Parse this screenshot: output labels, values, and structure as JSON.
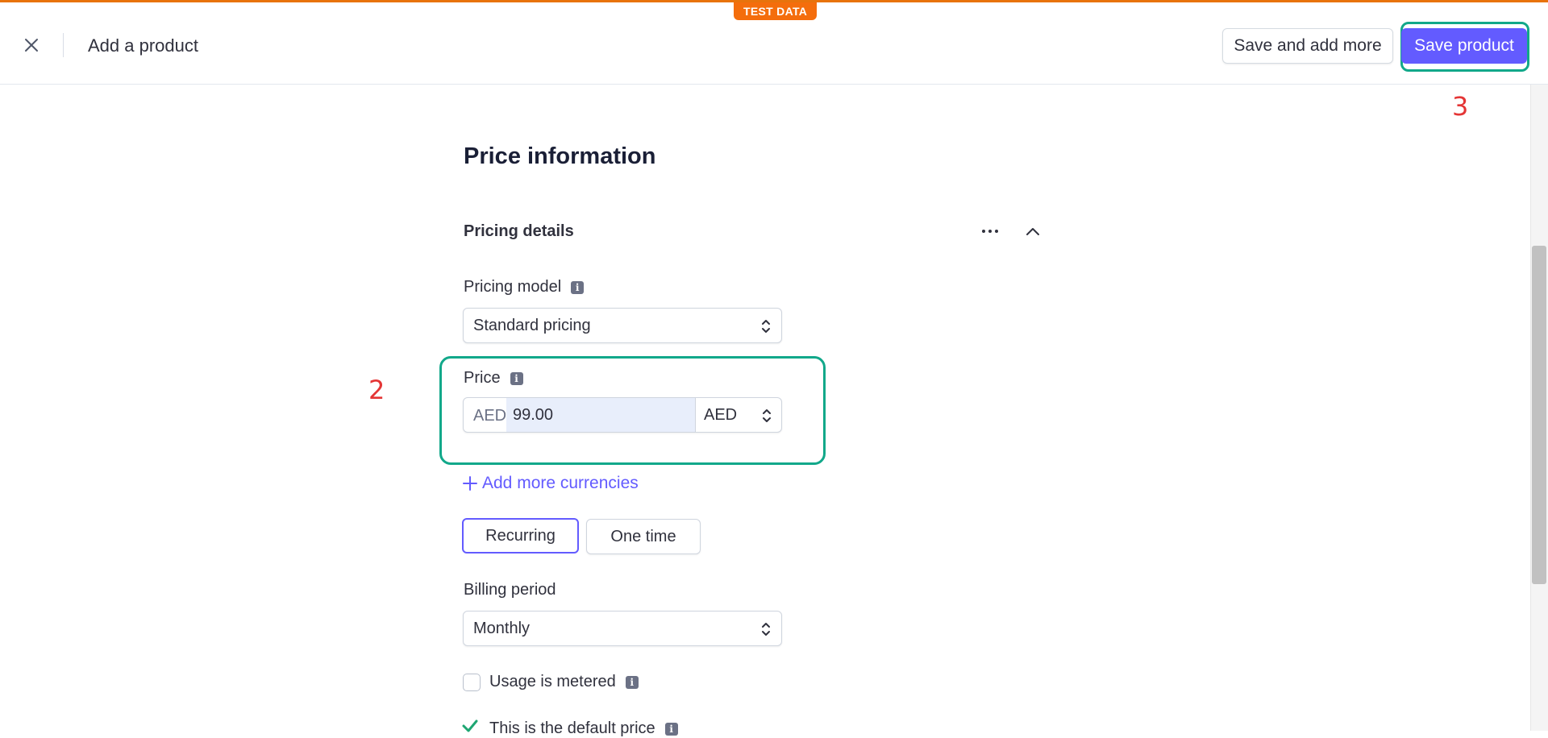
{
  "banner": {
    "badge": "TEST DATA"
  },
  "header": {
    "title": "Add a product",
    "close_icon": "close-icon",
    "save_more_label": "Save and add more",
    "save_label": "Save product"
  },
  "annotations": {
    "price_step": "2",
    "save_step": "3"
  },
  "section": {
    "title": "Price information",
    "subtitle": "Pricing details",
    "menu_icon": "more-horizontal-icon",
    "collapse_icon": "chevron-up-icon"
  },
  "pricing_model": {
    "label": "Pricing model",
    "value": "Standard pricing"
  },
  "price": {
    "label": "Price",
    "prefix": "AED",
    "value": "99.00",
    "currency": "AED"
  },
  "add_currencies": {
    "label": "Add more currencies",
    "icon": "plus-icon"
  },
  "type_toggle": {
    "options": [
      "Recurring",
      "One time"
    ],
    "selected": "Recurring"
  },
  "billing_period": {
    "label": "Billing period",
    "value": "Monthly"
  },
  "metered": {
    "label": "Usage is metered",
    "checked": false
  },
  "default_price": {
    "label": "This is the default price",
    "checked": true
  },
  "colors": {
    "accent": "#635bff",
    "highlight": "#12a88a",
    "badge": "#f46d0c",
    "step_number": "#e43535"
  }
}
